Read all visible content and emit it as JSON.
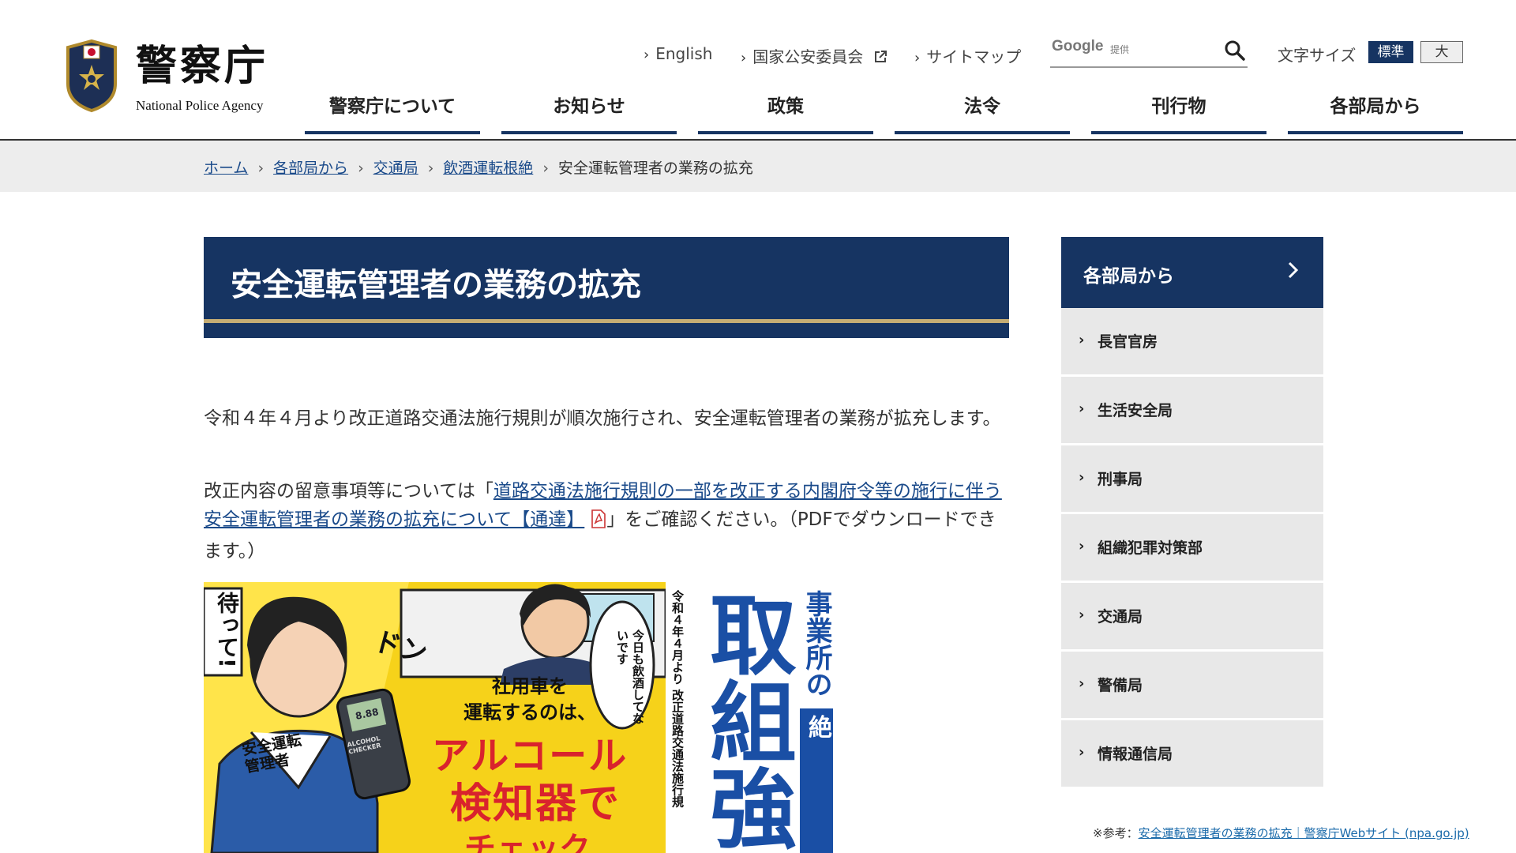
{
  "header": {
    "site_name": "警察庁",
    "site_name_en": "National Police Agency",
    "util_links": [
      "English",
      "国家公安委員会",
      "サイトマップ"
    ],
    "search": {
      "brand": "Google",
      "brand_sub": "提供",
      "placeholder": ""
    },
    "font_size": {
      "label": "文字サイズ",
      "standard": "標準",
      "large": "大"
    }
  },
  "nav": [
    "警察庁について",
    "お知らせ",
    "政策",
    "法令",
    "刊行物",
    "各部局から"
  ],
  "breadcrumb": {
    "links": [
      "ホーム",
      "各部局から",
      "交通局",
      "飲酒運転根絶"
    ],
    "current": "安全運転管理者の業務の拡充"
  },
  "main": {
    "title": "安全運転管理者の業務の拡充",
    "para1": "令和４年４月より改正道路交通法施行規則が順次施行され、安全運転管理者の業務が拡充します。",
    "para2_before": "改正内容の留意事項等については「",
    "para2_link": "道路交通法施行規則の一部を改正する内閣府令等の施行に伴う安全運転管理者の業務の拡充について【通達】",
    "para2_after": "」をご確認ください。（PDFでダウンロードできます。）",
    "poster": {
      "wait": "待って!",
      "don": "ドン",
      "bubble": "今日も飲酒してないです",
      "badge": "安全運転管理者",
      "line1": "社用車を",
      "line2": "運転するのは、",
      "line3": "アルコール",
      "line4": "検知器で",
      "line5": "チェック",
      "device": "8.88",
      "device_sub": "ALCOHOL CHECKER",
      "vertical_note": "令和４年４月より 改正道路交通法施行規",
      "big_vertical": "取組強",
      "right_vertical_top": "事業所の",
      "right_vertical_box": "飲酒運転根絶"
    }
  },
  "sidebar": {
    "heading": "各部局から",
    "items": [
      "長官官房",
      "生活安全局",
      "刑事局",
      "組織犯罪対策部",
      "交通局",
      "警備局",
      "情報通信局"
    ]
  },
  "footnote": {
    "prefix": "※参考：",
    "link": "安全運転管理者の業務の拡充｜警察庁Webサイト (npa.go.jp)"
  },
  "colors": {
    "navy": "#163462",
    "gold": "#c5ad74",
    "link": "#1a4a8a"
  }
}
